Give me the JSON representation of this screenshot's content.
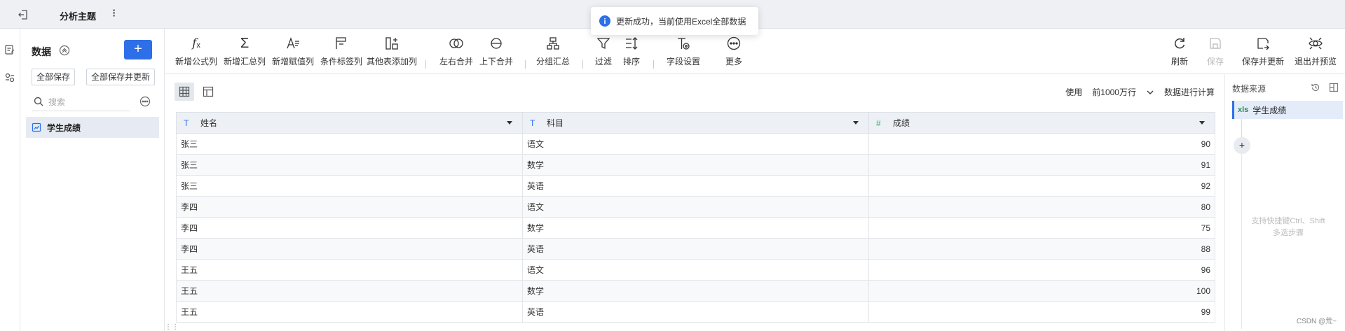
{
  "header": {
    "title": "分析主题",
    "more": "⋮",
    "toast": "更新成功，当前使用Excel全部数据"
  },
  "left_panel": {
    "title": "数据",
    "add_label": "+",
    "save_all": "全部保存",
    "save_all_update": "全部保存并更新",
    "search_placeholder": "搜索",
    "items": [
      {
        "label": "学生成绩"
      }
    ]
  },
  "toolbar": {
    "items": [
      {
        "label": "新增公式列",
        "icon": "formula-icon"
      },
      {
        "label": "新增汇总列",
        "icon": "sigma-icon"
      },
      {
        "label": "新增赋值列",
        "icon": "assign-icon"
      },
      {
        "label": "条件标签列",
        "icon": "flag-icon"
      },
      {
        "label": "其他表添加列",
        "icon": "add-column-icon"
      },
      {
        "label": "左右合并",
        "icon": "merge-horizontal-icon"
      },
      {
        "label": "上下合并",
        "icon": "merge-vertical-icon"
      },
      {
        "label": "分组汇总",
        "icon": "group-icon"
      },
      {
        "label": "过滤",
        "icon": "filter-icon"
      },
      {
        "label": "排序",
        "icon": "sort-icon"
      },
      {
        "label": "字段设置",
        "icon": "field-settings-icon"
      },
      {
        "label": "更多",
        "icon": "more-icon"
      }
    ],
    "right_items": [
      {
        "label": "刷新",
        "icon": "refresh-icon",
        "disabled": false
      },
      {
        "label": "保存",
        "icon": "save-icon",
        "disabled": true
      },
      {
        "label": "保存并更新",
        "icon": "save-update-icon",
        "disabled": false
      },
      {
        "label": "退出并预览",
        "icon": "preview-icon",
        "disabled": false
      }
    ]
  },
  "calc": {
    "prefix": "使用",
    "selected": "前1000万行",
    "suffix": "数据进行计算"
  },
  "table": {
    "columns": [
      {
        "name": "姓名",
        "type": "text",
        "type_glyph": "T"
      },
      {
        "name": "科目",
        "type": "text",
        "type_glyph": "T"
      },
      {
        "name": "成绩",
        "type": "number",
        "type_glyph": "#"
      }
    ],
    "rows": [
      [
        "张三",
        "语文",
        "90"
      ],
      [
        "张三",
        "数学",
        "91"
      ],
      [
        "张三",
        "英语",
        "92"
      ],
      [
        "李四",
        "语文",
        "80"
      ],
      [
        "李四",
        "数学",
        "75"
      ],
      [
        "李四",
        "英语",
        "88"
      ],
      [
        "王五",
        "语文",
        "96"
      ],
      [
        "王五",
        "数学",
        "100"
      ],
      [
        "王五",
        "英语",
        "99"
      ]
    ]
  },
  "right_panel": {
    "title": "数据来源",
    "source_type": "xls",
    "source_name": "学生成绩",
    "add_label": "+",
    "hint_line1": "支持快捷键Ctrl、Shift",
    "hint_line2": "多选步骤"
  },
  "watermark": "CSDN @荒~",
  "colors": {
    "accent": "#2d6fe8",
    "number_type": "#3aa76d",
    "excel": "#2e8b57"
  }
}
